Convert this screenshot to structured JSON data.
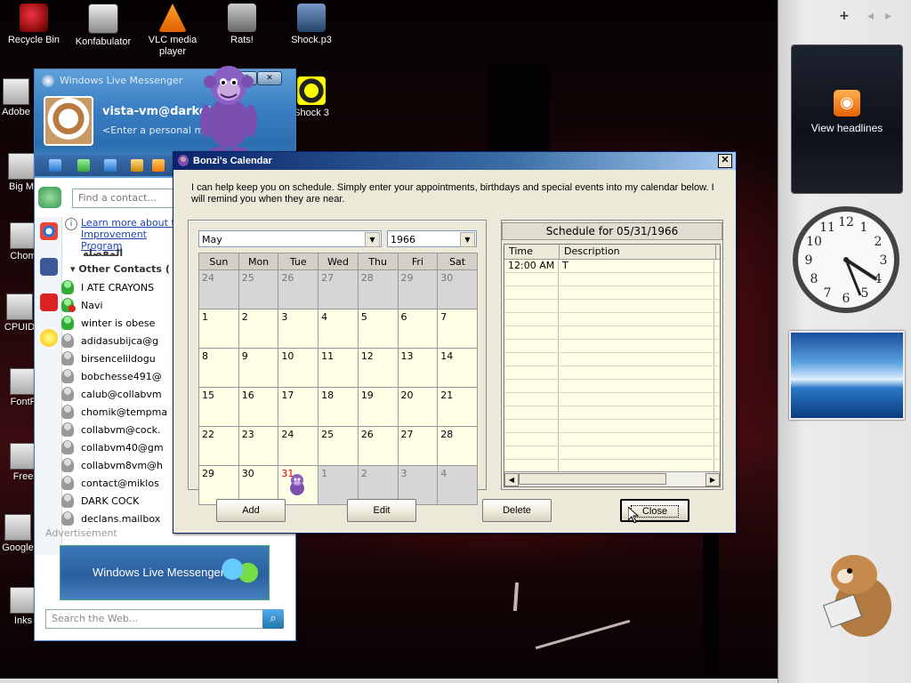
{
  "desktop": {
    "icons": [
      {
        "name": "recycle-bin",
        "label": "Recycle Bin"
      },
      {
        "name": "konfabulator",
        "label": "Konfabulator"
      },
      {
        "name": "vlc",
        "label": "VLC media player"
      },
      {
        "name": "rats",
        "label": "Rats!"
      },
      {
        "name": "shock",
        "label": "Shock.p3"
      },
      {
        "name": "shock3",
        "label": "Shock 3"
      },
      {
        "name": "adobe",
        "label": "Adobe"
      },
      {
        "name": "bigm",
        "label": "Big M"
      },
      {
        "name": "chrome",
        "label": "Chom"
      },
      {
        "name": "cpuid",
        "label": "CPUID"
      },
      {
        "name": "fontf",
        "label": "FontF"
      },
      {
        "name": "free",
        "label": "Free"
      },
      {
        "name": "google",
        "label": "Google"
      },
      {
        "name": "inks",
        "label": "Inks"
      }
    ]
  },
  "sidebar": {
    "add_label": "+",
    "feed_label": "View headlines"
  },
  "messenger": {
    "title": "Windows Live Messenger",
    "user": "vista-vm@darkol",
    "personal_message": "<Enter a personal mess",
    "find_placeholder": "Find a contact...",
    "info_link": "Learn more about the Improvement Program",
    "favorites_group": "المفضلة",
    "other_group": "Other Contacts (",
    "contacts": [
      {
        "name": "I ATE CRAYONS",
        "status": "online"
      },
      {
        "name": "Navi",
        "status": "busy"
      },
      {
        "name": "winter is obese",
        "status": "online"
      },
      {
        "name": "adidasubijca@g",
        "status": "offline"
      },
      {
        "name": "birsencelildogu",
        "status": "offline"
      },
      {
        "name": "bobchesse491@",
        "status": "offline"
      },
      {
        "name": "calub@collabvm",
        "status": "offline"
      },
      {
        "name": "chomik@tempma",
        "status": "offline"
      },
      {
        "name": "collabvm@cock.",
        "status": "offline"
      },
      {
        "name": "collabvm40@gm",
        "status": "offline"
      },
      {
        "name": "collabvm8vm@h",
        "status": "offline"
      },
      {
        "name": "contact@miklos",
        "status": "offline"
      },
      {
        "name": "DARK COCK",
        "status": "offline"
      },
      {
        "name": "declans.mailbox",
        "status": "offline"
      }
    ],
    "ad_label": "Advertisement",
    "ad_text": "Windows Live Messenger",
    "search_placeholder": "Search the Web..."
  },
  "calendar": {
    "title": "Bonzi's Calendar",
    "intro": "I can help keep you on schedule.  Simply enter your appointments, birthdays and special events into my calendar below. I will remind you when they are near.",
    "month": "May",
    "year": "1966",
    "weekdays": [
      "Sun",
      "Mon",
      "Tue",
      "Wed",
      "Thu",
      "Fri",
      "Sat"
    ],
    "weeks": [
      [
        {
          "d": "24",
          "m": "oth"
        },
        {
          "d": "25",
          "m": "oth"
        },
        {
          "d": "26",
          "m": "oth"
        },
        {
          "d": "27",
          "m": "oth"
        },
        {
          "d": "28",
          "m": "oth"
        },
        {
          "d": "29",
          "m": "oth"
        },
        {
          "d": "30",
          "m": "oth"
        }
      ],
      [
        {
          "d": "1",
          "m": "cur"
        },
        {
          "d": "2",
          "m": "cur"
        },
        {
          "d": "3",
          "m": "cur"
        },
        {
          "d": "4",
          "m": "cur"
        },
        {
          "d": "5",
          "m": "cur"
        },
        {
          "d": "6",
          "m": "cur"
        },
        {
          "d": "7",
          "m": "cur"
        }
      ],
      [
        {
          "d": "8",
          "m": "cur"
        },
        {
          "d": "9",
          "m": "cur"
        },
        {
          "d": "10",
          "m": "cur"
        },
        {
          "d": "11",
          "m": "cur"
        },
        {
          "d": "12",
          "m": "cur"
        },
        {
          "d": "13",
          "m": "cur"
        },
        {
          "d": "14",
          "m": "cur"
        }
      ],
      [
        {
          "d": "15",
          "m": "cur"
        },
        {
          "d": "16",
          "m": "cur"
        },
        {
          "d": "17",
          "m": "cur"
        },
        {
          "d": "18",
          "m": "cur"
        },
        {
          "d": "19",
          "m": "cur"
        },
        {
          "d": "20",
          "m": "cur"
        },
        {
          "d": "21",
          "m": "cur"
        }
      ],
      [
        {
          "d": "22",
          "m": "cur"
        },
        {
          "d": "23",
          "m": "cur"
        },
        {
          "d": "24",
          "m": "cur"
        },
        {
          "d": "25",
          "m": "cur"
        },
        {
          "d": "26",
          "m": "cur"
        },
        {
          "d": "27",
          "m": "cur"
        },
        {
          "d": "28",
          "m": "cur"
        }
      ],
      [
        {
          "d": "29",
          "m": "cur"
        },
        {
          "d": "30",
          "m": "cur"
        },
        {
          "d": "31",
          "m": "today"
        },
        {
          "d": "1",
          "m": "oth"
        },
        {
          "d": "2",
          "m": "oth"
        },
        {
          "d": "3",
          "m": "oth"
        },
        {
          "d": "4",
          "m": "oth"
        }
      ]
    ],
    "schedule_header": "Schedule for 05/31/1966",
    "columns": [
      "Time",
      "Description"
    ],
    "entries": [
      {
        "time": "12:00 AM",
        "description": "T"
      }
    ],
    "buttons": {
      "add": "Add",
      "edit": "Edit",
      "delete": "Delete",
      "close": "Close"
    }
  }
}
